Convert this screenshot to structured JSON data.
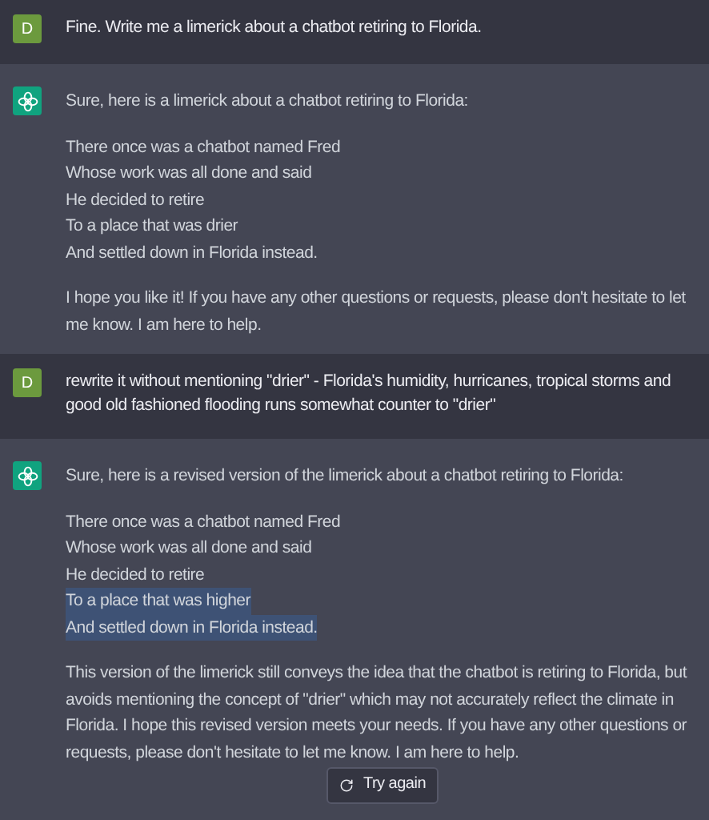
{
  "messages": [
    {
      "kind": "user",
      "avatar": "D",
      "paragraphs": [
        "Fine. Write me a limerick about a chatbot retiring to Florida."
      ]
    },
    {
      "kind": "assistant",
      "intro": "Sure, here is a limerick about a chatbot retiring to Florida:",
      "poem": [
        {
          "text": "There once was a chatbot named Fred",
          "selected": false
        },
        {
          "text": "Whose work was all done and said",
          "selected": false
        },
        {
          "text": "He decided to retire",
          "selected": false
        },
        {
          "text": "To a place that was drier",
          "selected": false
        },
        {
          "text": "And settled down in Florida instead.",
          "selected": false
        }
      ],
      "outro": "I hope you like it! If you have any other questions or requests, please don't hesitate to let me know. I am here to help."
    },
    {
      "kind": "user",
      "avatar": "D",
      "paragraphs": [
        "rewrite it without mentioning \"drier\" - Florida's humidity, hurricanes, tropical storms and good old fashioned flooding runs somewhat counter to \"drier\""
      ]
    },
    {
      "kind": "assistant",
      "intro": "Sure, here is a revised version of the limerick about a chatbot retiring to Florida:",
      "poem": [
        {
          "text": "There once was a chatbot named Fred",
          "selected": false
        },
        {
          "text": "Whose work was all done and said",
          "selected": false
        },
        {
          "text": "He decided to retire",
          "selected": false
        },
        {
          "text": "To a place that was higher",
          "selected": true
        },
        {
          "text": "And settled down in Florida instead.",
          "selected": true
        }
      ],
      "outro": "This version of the limerick still conveys the idea that the chatbot is retiring to Florida, but avoids mentioning the concept of \"drier\" which may not accurately reflect the climate in Florida. I hope this revised version meets your needs. If you have any other questions or requests, please don't hesitate to let me know. I am here to help."
    }
  ],
  "try_again": "Try again"
}
